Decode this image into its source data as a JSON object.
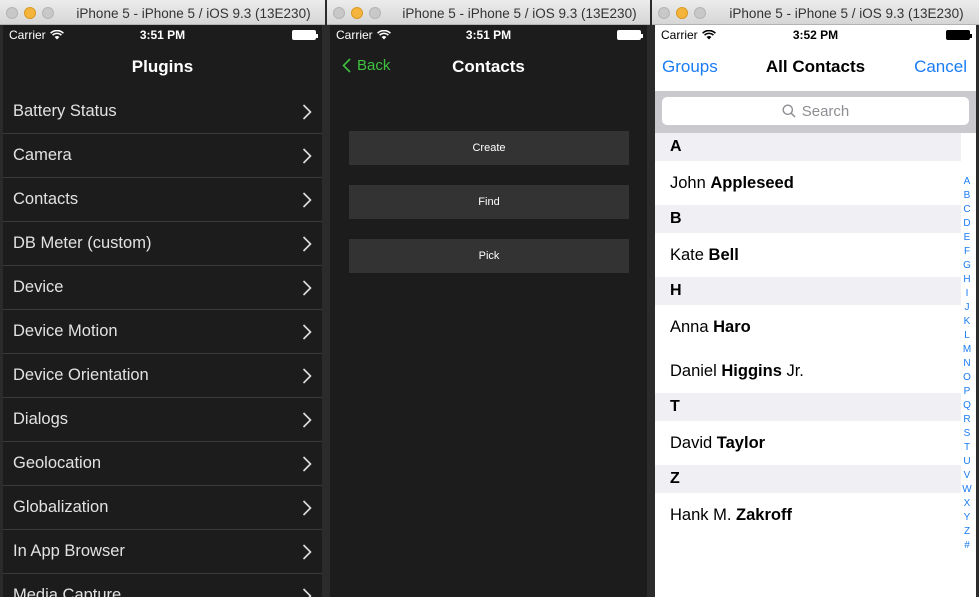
{
  "simulators": [
    {
      "title": "iPhone 5 - iPhone 5 / iOS 9.3 (13E230)"
    },
    {
      "title": "iPhone 5 - iPhone 5 / iOS 9.3 (13E230)"
    },
    {
      "title": "iPhone 5 - iPhone 5 / iOS 9.3 (13E230)"
    }
  ],
  "status": [
    {
      "carrier": "Carrier",
      "time": "3:51 PM"
    },
    {
      "carrier": "Carrier",
      "time": "3:51 PM"
    },
    {
      "carrier": "Carrier",
      "time": "3:52 PM"
    }
  ],
  "plugins": {
    "title": "Plugins",
    "items": [
      "Battery Status",
      "Camera",
      "Contacts",
      "DB Meter (custom)",
      "Device",
      "Device Motion",
      "Device Orientation",
      "Dialogs",
      "Geolocation",
      "Globalization",
      "In App Browser",
      "Media Capture"
    ]
  },
  "contacts": {
    "back": "Back",
    "title": "Contacts",
    "buttons": [
      "Create",
      "Find",
      "Pick"
    ]
  },
  "all_contacts": {
    "left": "Groups",
    "title": "All Contacts",
    "right": "Cancel",
    "search_placeholder": "Search",
    "sections": [
      {
        "letter": "A",
        "rows": [
          {
            "first": "John",
            "last": "Appleseed",
            "suffix": ""
          }
        ]
      },
      {
        "letter": "B",
        "rows": [
          {
            "first": "Kate",
            "last": "Bell",
            "suffix": ""
          }
        ]
      },
      {
        "letter": "H",
        "rows": [
          {
            "first": "Anna",
            "last": "Haro",
            "suffix": ""
          },
          {
            "first": "Daniel",
            "last": "Higgins",
            "suffix": "Jr."
          }
        ]
      },
      {
        "letter": "T",
        "rows": [
          {
            "first": "David",
            "last": "Taylor",
            "suffix": ""
          }
        ]
      },
      {
        "letter": "Z",
        "rows": [
          {
            "first": "Hank M.",
            "last": "Zakroff",
            "suffix": ""
          }
        ]
      }
    ],
    "index": [
      "A",
      "B",
      "C",
      "D",
      "E",
      "F",
      "G",
      "H",
      "I",
      "J",
      "K",
      "L",
      "M",
      "N",
      "O",
      "P",
      "Q",
      "R",
      "S",
      "T",
      "U",
      "V",
      "W",
      "X",
      "Y",
      "Z",
      "#"
    ]
  },
  "colors": {
    "accent_green": "#3ec13e",
    "accent_blue": "#1a7cf5"
  }
}
